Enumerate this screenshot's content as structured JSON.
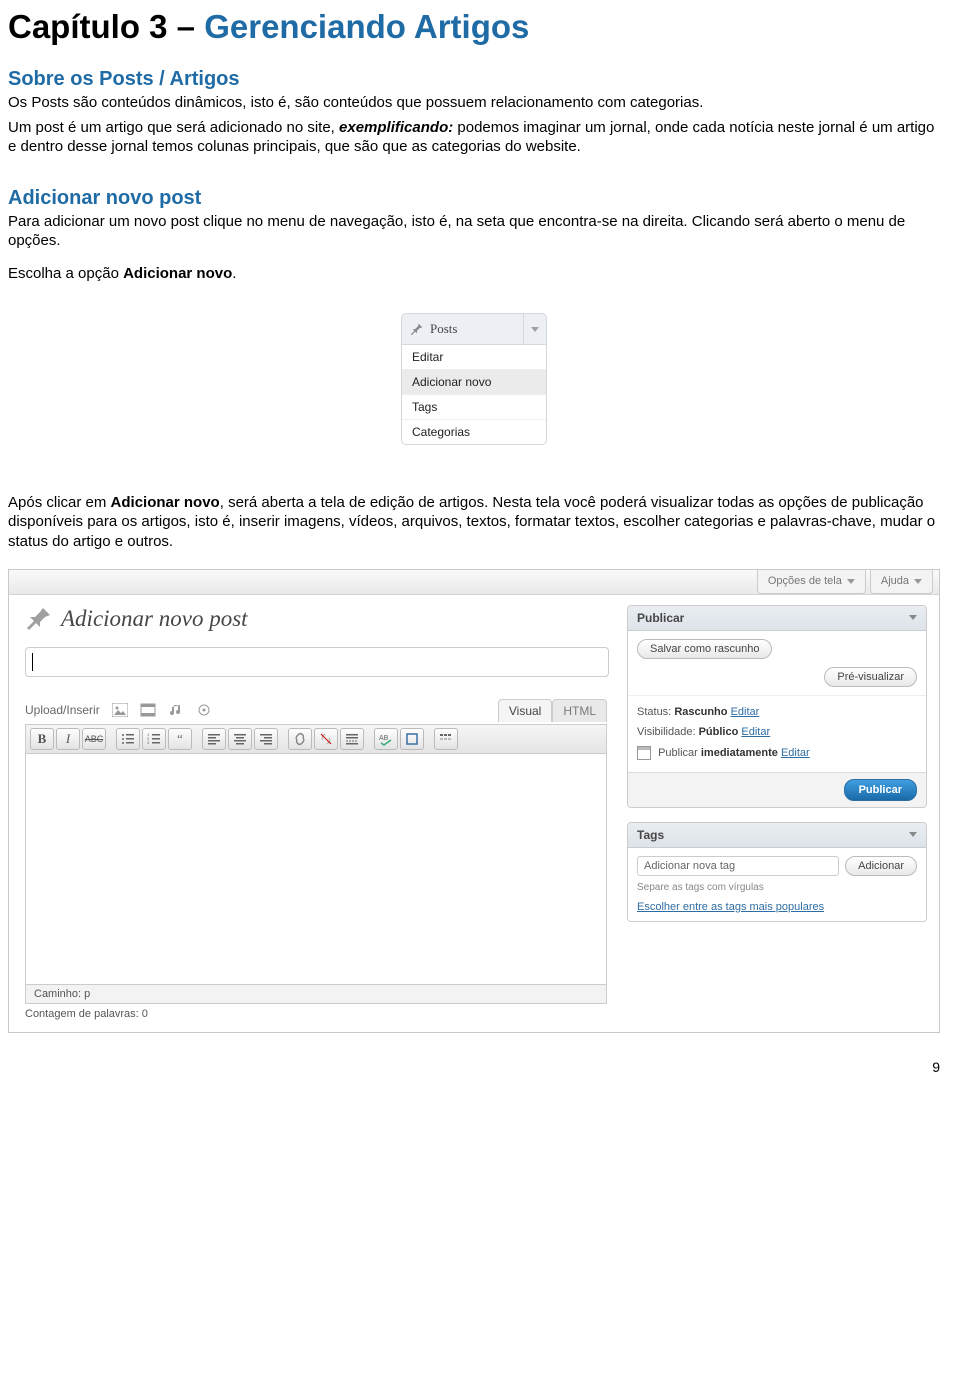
{
  "chapter": {
    "prefix": "Capítulo 3 – ",
    "title": "Gerenciando Artigos"
  },
  "section1": {
    "heading": "Sobre os Posts / Artigos",
    "para1": "Os Posts são conteúdos dinâmicos, isto é, são conteúdos que possuem relacionamento com categorias.",
    "para2_a": "Um post é um artigo que será adicionado no site, ",
    "para2_em": "exemplificando:",
    "para2_b": " podemos imaginar um jornal, onde cada notícia neste jornal é um artigo e dentro desse jornal temos colunas principais, que são que as categorias do website."
  },
  "section2": {
    "heading": "Adicionar novo post",
    "para1": "Para adicionar um novo post clique no menu de navegação, isto é, na seta que encontra-se na direita. Clicando será aberto o menu de opções.",
    "para2_a": "Escolha a opção ",
    "para2_b": "Adicionar novo",
    "para2_c": "."
  },
  "menu": {
    "title": "Posts",
    "items": [
      "Editar",
      "Adicionar novo",
      "Tags",
      "Categorias"
    ]
  },
  "section3": {
    "para_a": "Após clicar em ",
    "para_b": "Adicionar novo",
    "para_c": ", será aberta a tela de edição de artigos. Nesta tela você poderá visualizar todas as opções de publicação disponíveis para os artigos, isto é, inserir imagens, vídeos, arquivos, textos, formatar textos, escolher categorias e palavras-chave, mudar o status do artigo e outros."
  },
  "editor": {
    "screen_options": "Opções de tela",
    "help": "Ajuda",
    "page_title": "Adicionar novo post",
    "upload_label": "Upload/Inserir",
    "tab_visual": "Visual",
    "tab_html": "HTML",
    "path_label": "Caminho: p",
    "word_count": "Contagem de palavras: 0",
    "publish": {
      "box_title": "Publicar",
      "save_draft": "Salvar como rascunho",
      "preview": "Pré-visualizar",
      "status_label": "Status:",
      "status_value": "Rascunho",
      "edit": "Editar",
      "visibility_label": "Visibilidade:",
      "visibility_value": "Público",
      "schedule_a": "Publicar ",
      "schedule_b": "imediatamente",
      "publish_btn": "Publicar"
    },
    "tags": {
      "box_title": "Tags",
      "placeholder": "Adicionar nova tag",
      "add_btn": "Adicionar",
      "help": "Separe as tags com vírgulas",
      "choose": "Escolher entre as tags mais populares"
    }
  },
  "page_number": "9"
}
